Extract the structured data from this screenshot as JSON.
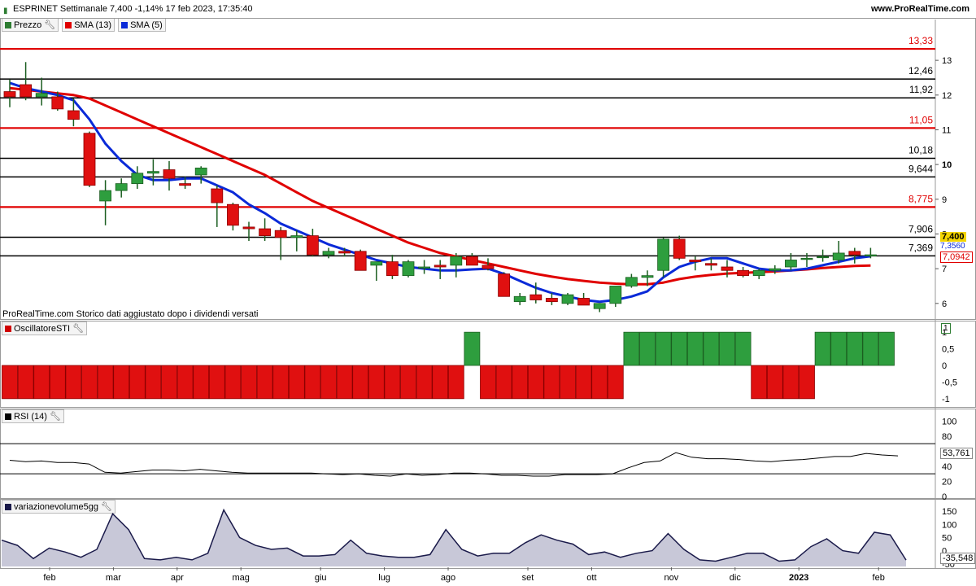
{
  "header": {
    "title": "ESPRINET Settimanale 7,400 -1,14% 17 feb 2023, 17:35:40",
    "website": "www.ProRealTime.com"
  },
  "price_panel": {
    "legend": [
      {
        "label": "Prezzo",
        "color": "#2e7d32",
        "icon": "candles-icon"
      },
      {
        "label": "SMA (13)",
        "color": "#e00000"
      },
      {
        "label": "SMA (5)",
        "color": "#0a2ad8"
      }
    ],
    "footer_note": "ProRealTime.com  Storico dati aggiustato dopo i dividendi versati",
    "last_price_tag": "7,400",
    "sma5_tag": "7,3560",
    "sma13_tag": "7,0942"
  },
  "sti_panel": {
    "legend": "OscillatoreSTI",
    "current_value": "1"
  },
  "rsi_panel": {
    "legend": "RSI (14)",
    "current_value": "53,761"
  },
  "vol_panel": {
    "legend": "variazionevolume5gg",
    "current_value": "-35,548"
  },
  "chart_data": [
    {
      "type": "candlestick",
      "title": "ESPRINET Settimanale",
      "x_axis_labels": [
        "feb",
        "mar",
        "apr",
        "mag",
        "giu",
        "lug",
        "ago",
        "set",
        "ott",
        "nov",
        "dic",
        "2023",
        "feb"
      ],
      "x_label_week_index": [
        2.5,
        6.5,
        10.5,
        14.5,
        19.5,
        23.5,
        27.5,
        32.5,
        36.5,
        41.5,
        45.5,
        49.5,
        54.5
      ],
      "ylim": [
        5.55,
        13.8
      ],
      "y_ticks": [
        6,
        7,
        8,
        9,
        10,
        11,
        12,
        13
      ],
      "horizontal_levels": [
        {
          "value": 13.33,
          "label": "13,33",
          "color": "#e00000"
        },
        {
          "value": 12.46,
          "label": "12,46",
          "color": "#000000"
        },
        {
          "value": 11.92,
          "label": "11,92",
          "color": "#000000"
        },
        {
          "value": 11.05,
          "label": "11,05",
          "color": "#e00000"
        },
        {
          "value": 10.18,
          "label": "10,18",
          "color": "#000000"
        },
        {
          "value": 9.644,
          "label": "9,644",
          "color": "#000000"
        },
        {
          "value": 8.775,
          "label": "8,775",
          "color": "#e00000"
        },
        {
          "value": 7.906,
          "label": "7,906",
          "color": "#000000"
        },
        {
          "value": 7.369,
          "label": "7,369",
          "color": "#000000"
        }
      ],
      "candles": [
        {
          "o": 12.1,
          "h": 12.45,
          "l": 11.65,
          "c": 11.95
        },
        {
          "o": 12.3,
          "h": 12.95,
          "l": 11.85,
          "c": 11.95
        },
        {
          "o": 11.95,
          "h": 12.5,
          "l": 11.7,
          "c": 12.05
        },
        {
          "o": 11.95,
          "h": 12.1,
          "l": 11.55,
          "c": 11.6
        },
        {
          "o": 11.55,
          "h": 11.9,
          "l": 11.1,
          "c": 11.3
        },
        {
          "o": 10.9,
          "h": 10.95,
          "l": 9.35,
          "c": 9.4
        },
        {
          "o": 8.95,
          "h": 9.55,
          "l": 8.25,
          "c": 9.25
        },
        {
          "o": 9.25,
          "h": 9.6,
          "l": 9.05,
          "c": 9.45
        },
        {
          "o": 9.45,
          "h": 9.95,
          "l": 9.3,
          "c": 9.75
        },
        {
          "o": 9.75,
          "h": 10.15,
          "l": 9.4,
          "c": 9.8
        },
        {
          "o": 9.85,
          "h": 10.1,
          "l": 9.25,
          "c": 9.6
        },
        {
          "o": 9.45,
          "h": 9.65,
          "l": 9.3,
          "c": 9.4
        },
        {
          "o": 9.7,
          "h": 9.95,
          "l": 9.45,
          "c": 9.9
        },
        {
          "o": 9.3,
          "h": 9.4,
          "l": 8.2,
          "c": 8.9
        },
        {
          "o": 8.85,
          "h": 8.9,
          "l": 8.1,
          "c": 8.25
        },
        {
          "o": 8.2,
          "h": 8.35,
          "l": 7.8,
          "c": 8.15
        },
        {
          "o": 8.15,
          "h": 8.45,
          "l": 7.8,
          "c": 7.95
        },
        {
          "o": 8.1,
          "h": 8.2,
          "l": 7.25,
          "c": 7.9
        },
        {
          "o": 7.9,
          "h": 8.1,
          "l": 7.5,
          "c": 7.95
        },
        {
          "o": 7.95,
          "h": 8.15,
          "l": 7.35,
          "c": 7.4
        },
        {
          "o": 7.4,
          "h": 7.6,
          "l": 7.3,
          "c": 7.5
        },
        {
          "o": 7.5,
          "h": 7.6,
          "l": 7.35,
          "c": 7.45
        },
        {
          "o": 7.5,
          "h": 7.55,
          "l": 6.95,
          "c": 6.95
        },
        {
          "o": 7.1,
          "h": 7.2,
          "l": 6.65,
          "c": 7.2
        },
        {
          "o": 7.2,
          "h": 7.4,
          "l": 6.7,
          "c": 6.8
        },
        {
          "o": 6.8,
          "h": 7.25,
          "l": 6.75,
          "c": 7.2
        },
        {
          "o": 7.05,
          "h": 7.25,
          "l": 6.85,
          "c": 7.05
        },
        {
          "o": 7.1,
          "h": 7.25,
          "l": 6.7,
          "c": 7.05
        },
        {
          "o": 7.1,
          "h": 7.45,
          "l": 6.75,
          "c": 7.35
        },
        {
          "o": 7.35,
          "h": 7.45,
          "l": 7.1,
          "c": 7.1
        },
        {
          "o": 7.1,
          "h": 7.3,
          "l": 6.95,
          "c": 7.0
        },
        {
          "o": 6.85,
          "h": 6.9,
          "l": 6.2,
          "c": 6.2
        },
        {
          "o": 6.05,
          "h": 6.3,
          "l": 5.95,
          "c": 6.2
        },
        {
          "o": 6.25,
          "h": 6.6,
          "l": 6.0,
          "c": 6.1
        },
        {
          "o": 6.15,
          "h": 6.3,
          "l": 5.95,
          "c": 6.05
        },
        {
          "o": 6.0,
          "h": 6.3,
          "l": 5.95,
          "c": 6.25
        },
        {
          "o": 6.15,
          "h": 6.3,
          "l": 5.95,
          "c": 5.95
        },
        {
          "o": 5.85,
          "h": 5.95,
          "l": 5.75,
          "c": 6.0
        },
        {
          "o": 6.0,
          "h": 6.5,
          "l": 5.9,
          "c": 6.5
        },
        {
          "o": 6.5,
          "h": 6.85,
          "l": 6.45,
          "c": 6.75
        },
        {
          "o": 6.75,
          "h": 6.95,
          "l": 6.5,
          "c": 6.8
        },
        {
          "o": 6.95,
          "h": 7.9,
          "l": 6.75,
          "c": 7.85
        },
        {
          "o": 7.85,
          "h": 7.95,
          "l": 7.25,
          "c": 7.3
        },
        {
          "o": 7.25,
          "h": 7.35,
          "l": 6.95,
          "c": 7.2
        },
        {
          "o": 7.15,
          "h": 7.3,
          "l": 6.95,
          "c": 7.1
        },
        {
          "o": 7.05,
          "h": 7.25,
          "l": 6.75,
          "c": 6.95
        },
        {
          "o": 6.95,
          "h": 7.05,
          "l": 6.75,
          "c": 6.8
        },
        {
          "o": 6.8,
          "h": 7.0,
          "l": 6.7,
          "c": 6.95
        },
        {
          "o": 6.95,
          "h": 7.1,
          "l": 6.85,
          "c": 7.0
        },
        {
          "o": 7.05,
          "h": 7.45,
          "l": 6.95,
          "c": 7.25
        },
        {
          "o": 7.3,
          "h": 7.45,
          "l": 7.05,
          "c": 7.3
        },
        {
          "o": 7.35,
          "h": 7.55,
          "l": 7.2,
          "c": 7.35
        },
        {
          "o": 7.25,
          "h": 7.8,
          "l": 7.15,
          "c": 7.45
        },
        {
          "o": 7.5,
          "h": 7.6,
          "l": 7.15,
          "c": 7.4
        },
        {
          "o": 7.4,
          "h": 7.6,
          "l": 7.3,
          "c": 7.4
        }
      ],
      "series": [
        {
          "name": "SMA (13)",
          "color": "#e00000",
          "values": [
            12.2,
            12.15,
            12.1,
            12.05,
            12.0,
            11.9,
            11.7,
            11.5,
            11.3,
            11.1,
            10.9,
            10.7,
            10.5,
            10.3,
            10.1,
            9.9,
            9.7,
            9.45,
            9.2,
            8.95,
            8.75,
            8.55,
            8.35,
            8.15,
            7.95,
            7.75,
            7.6,
            7.45,
            7.35,
            7.25,
            7.15,
            7.05,
            6.95,
            6.85,
            6.77,
            6.7,
            6.65,
            6.6,
            6.57,
            6.55,
            6.55,
            6.6,
            6.7,
            6.77,
            6.82,
            6.86,
            6.88,
            6.9,
            6.92,
            6.95,
            6.98,
            7.02,
            7.05,
            7.08,
            7.09
          ]
        },
        {
          "name": "SMA (5)",
          "color": "#0a2ad8",
          "values": [
            12.35,
            12.2,
            12.1,
            12.0,
            11.85,
            11.3,
            10.6,
            10.1,
            9.7,
            9.55,
            9.55,
            9.6,
            9.6,
            9.4,
            9.2,
            8.85,
            8.6,
            8.3,
            8.1,
            7.9,
            7.7,
            7.55,
            7.4,
            7.25,
            7.15,
            7.05,
            7.0,
            6.95,
            6.95,
            6.98,
            7.0,
            6.85,
            6.65,
            6.45,
            6.3,
            6.2,
            6.1,
            6.05,
            6.1,
            6.2,
            6.35,
            6.75,
            7.05,
            7.2,
            7.3,
            7.3,
            7.15,
            7.0,
            6.95,
            6.95,
            7.0,
            7.1,
            7.2,
            7.3,
            7.356
          ]
        }
      ]
    },
    {
      "type": "bar",
      "title": "OscillatoreSTI",
      "ylim": [
        -1.2,
        1.2
      ],
      "y_ticks": [
        "1",
        "0,5",
        "0",
        "-0,5",
        "-1"
      ],
      "values": [
        -1,
        -1,
        -1,
        -1,
        -1,
        -1,
        -1,
        -1,
        -1,
        -1,
        -1,
        -1,
        -1,
        -1,
        -1,
        -1,
        -1,
        -1,
        -1,
        -1,
        -1,
        -1,
        -1,
        -1,
        -1,
        -1,
        -1,
        -1,
        -1,
        1,
        -1,
        -1,
        -1,
        -1,
        -1,
        -1,
        -1,
        -1,
        -1,
        1,
        1,
        1,
        1,
        1,
        1,
        1,
        1,
        -1,
        -1,
        -1,
        -1,
        1,
        1,
        1,
        1,
        1
      ]
    },
    {
      "type": "line",
      "title": "RSI (14)",
      "ylim": [
        0,
        110
      ],
      "y_ticks": [
        "100",
        "80",
        "60",
        "40",
        "20",
        "0"
      ],
      "reference_lines": [
        70,
        30
      ],
      "values": [
        48,
        46,
        47,
        45,
        45,
        43,
        32,
        31,
        33,
        35,
        35,
        34,
        36,
        34,
        32,
        31,
        31,
        31,
        31,
        31,
        30,
        29,
        30,
        28,
        27,
        30,
        28,
        29,
        31,
        31,
        30,
        28,
        28,
        27,
        27,
        29,
        29,
        29,
        30,
        38,
        45,
        47,
        58,
        52,
        50,
        50,
        49,
        47,
        46,
        48,
        49,
        51,
        53,
        53,
        57,
        55,
        53.761
      ],
      "series_color": "#000000"
    },
    {
      "type": "area",
      "title": "variazionevolume5gg",
      "ylim": [
        -60,
        175
      ],
      "y_ticks": [
        "150",
        "100",
        "50",
        "0",
        "-50"
      ],
      "values": [
        40,
        20,
        -30,
        10,
        -5,
        -25,
        5,
        140,
        80,
        -30,
        -35,
        -25,
        -35,
        -10,
        155,
        50,
        20,
        5,
        10,
        -20,
        -20,
        -15,
        40,
        -10,
        -20,
        -25,
        -25,
        -15,
        80,
        5,
        -20,
        -10,
        -10,
        30,
        60,
        40,
        25,
        -15,
        -5,
        -25,
        -10,
        0,
        65,
        5,
        -35,
        -40,
        -25,
        -10,
        -10,
        -40,
        -35,
        15,
        45,
        0,
        -10,
        70,
        60,
        -35.548
      ],
      "fill_color": "#c8c8d8",
      "line_color": "#1a1a4a"
    }
  ]
}
